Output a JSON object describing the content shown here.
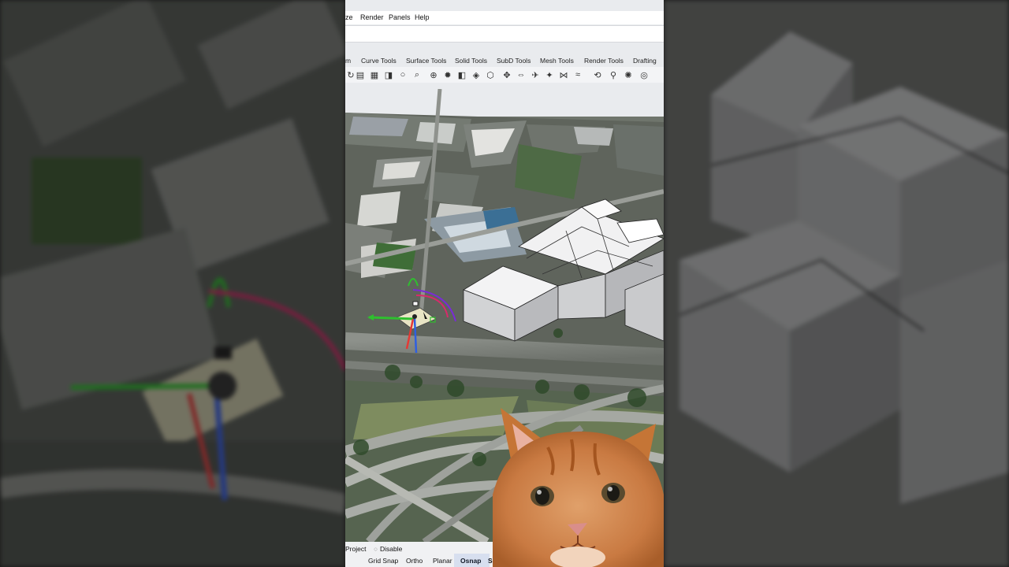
{
  "menu": {
    "items": [
      "ze",
      "Render",
      "Panels",
      "Help"
    ]
  },
  "toolbar_tabs": [
    "m",
    "Curve Tools",
    "Surface Tools",
    "Solid Tools",
    "SubD Tools",
    "Mesh Tools",
    "Render Tools",
    "Drafting"
  ],
  "toolbar_icons": [
    "rotate-icon",
    "save-icon",
    "print-icon",
    "open-folder-icon",
    "circle-icon",
    "zoom-icon",
    "target-icon",
    "snap-point-icon",
    "layer-icon",
    "cube-icon",
    "cplane-icon",
    "move-icon",
    "axis-icon",
    "plane-icon",
    "gumball-icon",
    "join-icon",
    "explode-icon",
    "rotate-view-icon",
    "walk-icon",
    "light-icon",
    "options-icon"
  ],
  "status": {
    "project_label": "Project",
    "disable_label": "Disable",
    "toggles": [
      "Grid Snap",
      "Ortho",
      "Planar",
      "Osnap",
      "SmartTr"
    ]
  },
  "colors": {
    "gumball_x": "#e53935",
    "gumball_y": "#2fbf2f",
    "gumball_z": "#2f5fe0",
    "rotation_arc": "#7a2ad8",
    "building_fill": "#eeeeef",
    "accent_bar": "#2a5fd8"
  }
}
